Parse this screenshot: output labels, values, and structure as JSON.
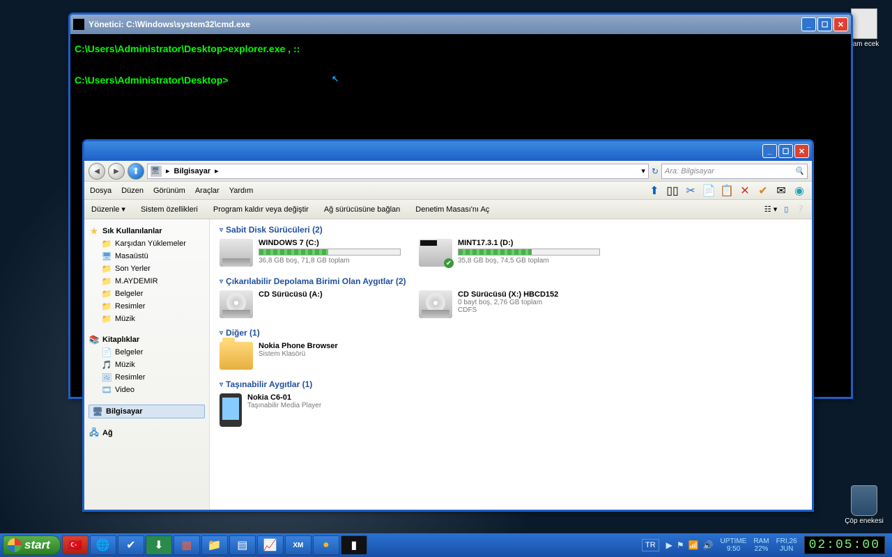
{
  "desktop_icons": {
    "doc": "vam ecek",
    "recycle": "Çöp enekesi"
  },
  "cmd": {
    "title": "Yönetici: C:\\Windows\\system32\\cmd.exe",
    "line1": "C:\\Users\\Administrator\\Desktop>explorer.exe , ::",
    "line2": "C:\\Users\\Administrator\\Desktop>"
  },
  "explorer": {
    "breadcrumb": {
      "root": "Bilgisayar",
      "sep": "▸"
    },
    "search_placeholder": "Ara: Bilgisayar",
    "menus": [
      "Dosya",
      "Düzen",
      "Görünüm",
      "Araçlar",
      "Yardım"
    ],
    "cmdbar": [
      "Düzenle ▾",
      "Sistem özellikleri",
      "Program kaldır veya değiştir",
      "Ağ sürücüsüne bağlan",
      "Denetim Masası'nı Aç"
    ],
    "sidebar": {
      "fav": {
        "hdr": "Sık Kullanılanlar",
        "items": [
          "Karşıdan Yüklemeler",
          "Masaüstü",
          "Son Yerler",
          "M.AYDEMIR",
          "Belgeler",
          "Resimler",
          "Müzik"
        ]
      },
      "lib": {
        "hdr": "Kitaplıklar",
        "items": [
          "Belgeler",
          "Müzik",
          "Resimler",
          "Video"
        ]
      },
      "comp": "Bilgisayar",
      "net": "Ağ"
    },
    "cats": {
      "hdd": {
        "hdr": "Sabit Disk Sürücüleri (2)",
        "d": [
          {
            "name": "WINDOWS 7 (C:)",
            "sub": "36,8 GB boş, 71,8 GB toplam",
            "fill": 49
          },
          {
            "name": "MINT17.3.1 (D:)",
            "sub": "35,8 GB boş, 74,5 GB toplam",
            "fill": 52
          }
        ]
      },
      "rem": {
        "hdr": "Çıkarılabilir Depolama Birimi Olan Aygıtlar (2)",
        "d": [
          {
            "name": "CD Sürücüsü (A:)",
            "sub": ""
          },
          {
            "name": "CD Sürücüsü (X:) HBCD152",
            "sub": "0 bayt boş, 2,76 GB toplam",
            "sub2": "CDFS"
          }
        ]
      },
      "other": {
        "hdr": "Diğer (1)",
        "name": "Nokia Phone Browser",
        "sub": "Sistem Klasörü"
      },
      "port": {
        "hdr": "Taşınabilir Aygıtlar (1)",
        "name": "Nokia C6-01",
        "sub": "Taşınabilir Media Player"
      }
    }
  },
  "taskbar": {
    "start": "start",
    "lang": "TR",
    "uptime": {
      "l": "UPTIME",
      "v": "9:50"
    },
    "ram": {
      "l": "RAM",
      "v": "22%"
    },
    "date": {
      "l": "FRI,26",
      "v": "JUN"
    },
    "clock": "02:05:00"
  }
}
